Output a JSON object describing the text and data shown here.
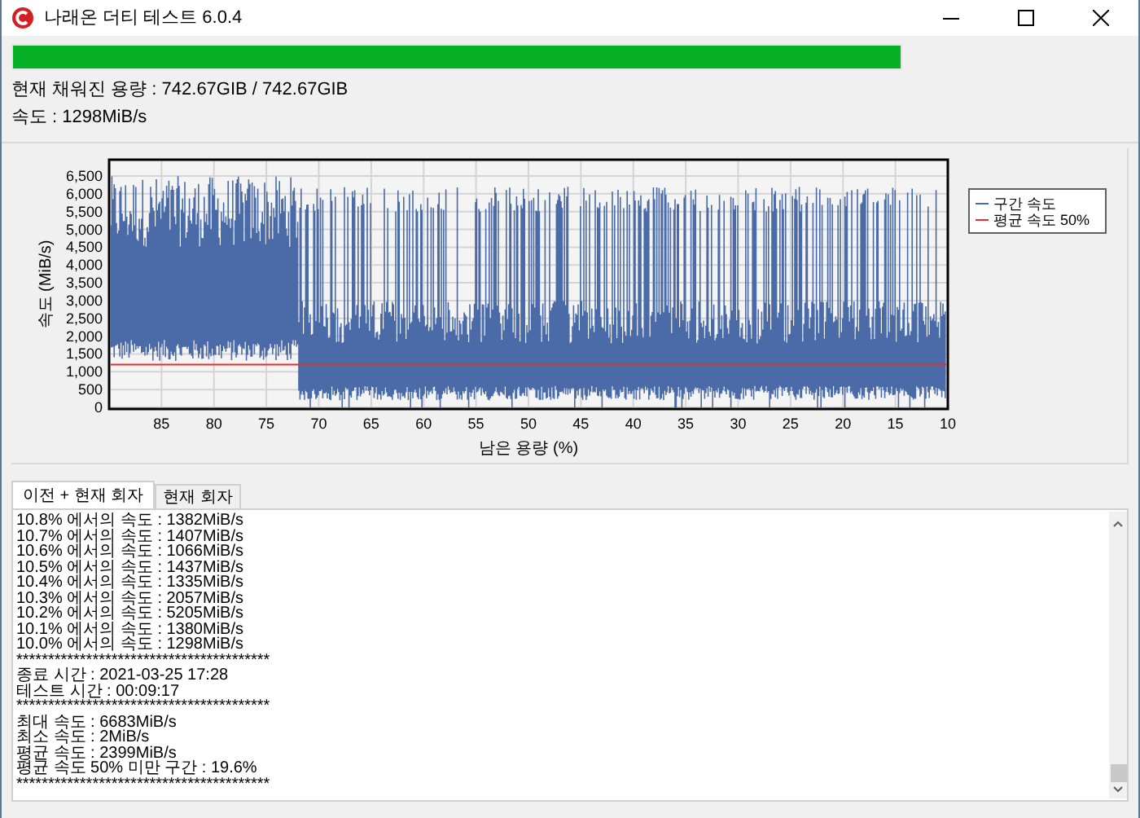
{
  "window": {
    "title": "나래온 더티 테스트 6.0.4"
  },
  "progress": {
    "level": 1
  },
  "status": [
    "현재 채워진 용량 : 742.67GIB / 742.67GIB",
    "속도 : 1298MiB/s"
  ],
  "chart": {
    "ylabel": "속도 (MiB/s)",
    "xlabel": "남은 용량 (%)",
    "yticks": [
      "6,500",
      "6,000",
      "5,500",
      "5,000",
      "4,500",
      "4,000",
      "3,500",
      "3,000",
      "2,500",
      "2,000",
      "1,500",
      "1,000",
      "500",
      "0"
    ],
    "xticks": [
      "85",
      "80",
      "75",
      "70",
      "65",
      "60",
      "55",
      "50",
      "45",
      "40",
      "35",
      "30",
      "25",
      "20",
      "15",
      "10"
    ],
    "legend": [
      {
        "label": "구간 속도",
        "color": "#4a6aa8"
      },
      {
        "label": "평균 속도 50%",
        "color": "#e03030"
      }
    ]
  },
  "tabs": [
    {
      "label": "이전 + 현재 회자",
      "selected": true
    },
    {
      "label": "현재 회자",
      "selected": false
    }
  ],
  "log": [
    "10.8% 에서의 속도 : 1382MiB/s",
    "10.7% 에서의 속도 : 1407MiB/s",
    "10.6% 에서의 속도 : 1066MiB/s",
    "10.5% 에서의 속도 : 1437MiB/s",
    "10.4% 에서의 속도 : 1335MiB/s",
    "10.3% 에서의 속도 : 2057MiB/s",
    "10.2% 에서의 속도 : 5205MiB/s",
    "10.1% 에서의 속도 : 1380MiB/s",
    "10.0% 에서의 속도 : 1298MiB/s",
    "****************************************",
    "종료 시간 : 2021-03-25 17:28",
    "테스트 시간 : 00:09:17",
    "****************************************",
    "최대 속도 : 6683MiB/s",
    "최소 속도 : 2MiB/s",
    "평균 속도 : 2399MiB/s",
    "평균 속도 50% 미만 구간 : 19.6%",
    "****************************************"
  ]
}
